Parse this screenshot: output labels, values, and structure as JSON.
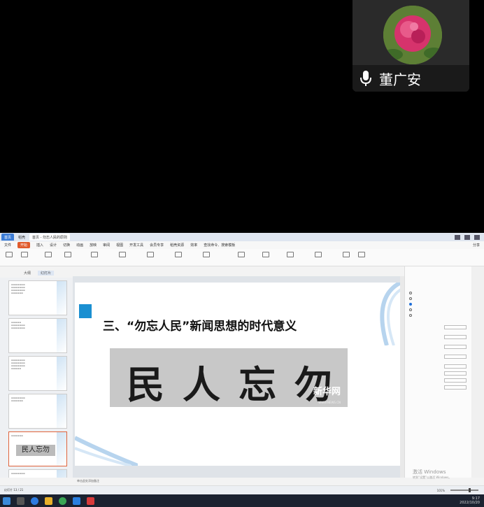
{
  "participant": {
    "name": "董广安",
    "mic_icon": "microphone-icon"
  },
  "window": {
    "tabs": [
      "首页",
      "稻壳",
      "首页 - 勿忘人民的原则"
    ],
    "menu": [
      "文件",
      "开始",
      "插入",
      "设计",
      "切换",
      "动画",
      "放映",
      "审阅",
      "视图",
      "开发工具",
      "会员专享",
      "稻壳资源",
      "效率"
    ],
    "start_label": "开始",
    "search_placeholder": "查找命令、搜索模板",
    "share_label": "分享"
  },
  "outline_tabs": {
    "outline": "大纲",
    "slides": "幻灯片"
  },
  "slide": {
    "title": "三、“勿忘人民”新闻思想的时代意义",
    "calligraphy": [
      "民",
      "人",
      "忘",
      "勿"
    ],
    "watermark": "新华网",
    "watermark_url": "WWW.NEWS.CN"
  },
  "notes_placeholder": "单击此处添加备注",
  "status": {
    "slide_counter": "幻灯片 13 / 21",
    "zoom": "101%"
  },
  "activation": {
    "line1": "激活 Windows",
    "line2": "转到“设置”以激活 Windows。"
  },
  "clock": {
    "time": "9:17",
    "date": "2022/10/20"
  },
  "colors": {
    "accent_blue": "#1a8fd1",
    "wps_orange": "#e05a2b",
    "taskbar": "#1b2230"
  }
}
